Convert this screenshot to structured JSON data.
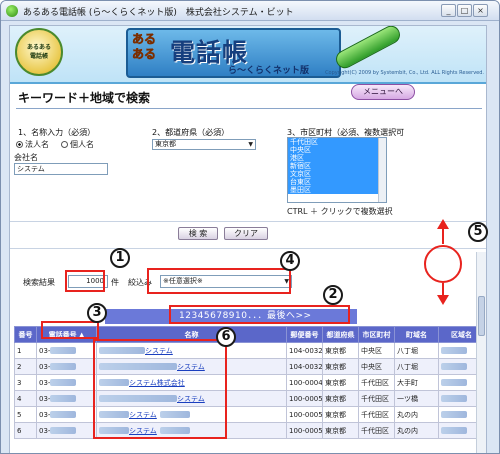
{
  "window": {
    "title": "あるある電話帳 (ら～くらくネット版)　株式会社システム・ビット",
    "minimize": "_",
    "maximize": "□",
    "close": "×"
  },
  "banner": {
    "logo_small_line1": "あるある",
    "logo_small_line2": "電話帳",
    "logo_aruaru": "あるある",
    "logo_title": "電話帳",
    "logo_sub": "ら～くらくネット版",
    "copyright": "Copyright(C) 2009 by Systembit, Co., Ltd. ALL Rights Reserved."
  },
  "page": {
    "heading": "キーワード＋地域で検索",
    "menu_button": "メニューへ"
  },
  "form": {
    "section1_label": "1、名称入力（必須）",
    "section2_label": "2、都道府県（必須）",
    "section3_label": "3、市区町村（必須、複数選択可",
    "radio_corp": "法人名",
    "radio_person": "個人名",
    "company_label": "会社名",
    "company_value": "システム",
    "prefecture_value": "東京都",
    "cities": [
      "千代田区",
      "中央区",
      "港区",
      "新宿区",
      "文京区",
      "台東区",
      "墨田区"
    ],
    "city_hint": "CTRL ＋ クリックで複数選択",
    "search_button": "検 索",
    "clear_button": "クリア"
  },
  "results": {
    "label": "検索結果",
    "count": "1000",
    "count_unit": "件",
    "filter_label": "絞込み",
    "filter_value": "※任意選択※",
    "pager": "12345678910．．．最後へ>>",
    "columns": [
      "番号",
      "電話番号 ▲",
      "名称",
      "郵便番号",
      "都道府県",
      "市区町村",
      "町域名",
      "区域名"
    ],
    "rows": [
      {
        "no": "1",
        "phone": "03-",
        "name": "システム",
        "zip": "104-0032",
        "pref": "東京都",
        "city": "中央区",
        "town": "八丁堀"
      },
      {
        "no": "2",
        "phone": "03-",
        "name": "システム",
        "zip": "104-0032",
        "pref": "東京都",
        "city": "中央区",
        "town": "八丁堀"
      },
      {
        "no": "3",
        "phone": "03-",
        "name": "システム株式会社",
        "zip": "100-0004",
        "pref": "東京都",
        "city": "千代田区",
        "town": "大手町"
      },
      {
        "no": "4",
        "phone": "03-",
        "name": "システム",
        "zip": "100-0005",
        "pref": "東京都",
        "city": "千代田区",
        "town": "一ツ橋"
      },
      {
        "no": "5",
        "phone": "03-",
        "name": "システム",
        "zip": "100-0005",
        "pref": "東京都",
        "city": "千代田区",
        "town": "丸の内"
      },
      {
        "no": "6",
        "phone": "03-",
        "name": "システム",
        "zip": "100-0005",
        "pref": "東京都",
        "city": "千代田区",
        "town": "丸の内"
      }
    ]
  },
  "callouts": [
    "1",
    "2",
    "3",
    "4",
    "5",
    "6"
  ],
  "colors": {
    "header": "#5b67c9",
    "pager": "#6b79d9",
    "annotation": "#e8231e",
    "selection": "#3399ff"
  }
}
